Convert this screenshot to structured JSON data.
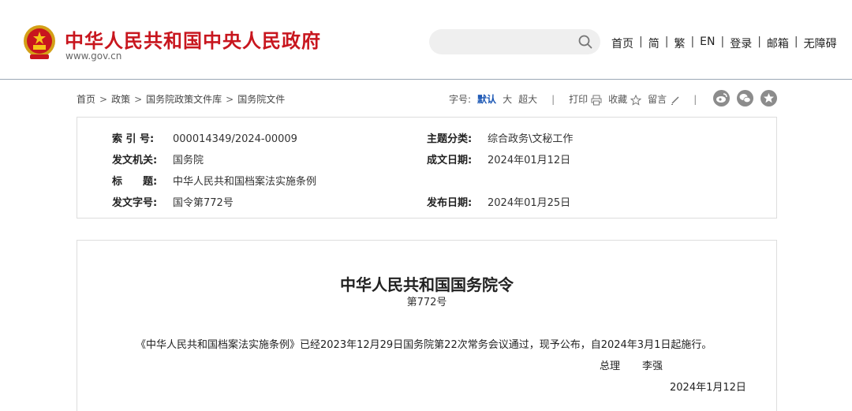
{
  "header": {
    "site_title": "中华人民共和国中央人民政府",
    "site_url": "www.gov.cn",
    "search": {
      "value": "",
      "placeholder": ""
    },
    "nav": [
      "首页",
      "简",
      "繁",
      "EN",
      "登录",
      "邮箱",
      "无障碍"
    ],
    "nav_separator": "|"
  },
  "breadcrumb": {
    "items": [
      "首页",
      "政策",
      "国务院政策文件库",
      "国务院文件"
    ],
    "separator": ">"
  },
  "toolbar": {
    "font_size_label": "字号:",
    "font_default": "默认",
    "font_large": "大",
    "font_xlarge": "超大",
    "divider": "|",
    "print_label": "打印",
    "favorite_label": "收藏",
    "comment_label": "留言"
  },
  "share_icons": [
    "weibo-icon",
    "wechat-icon",
    "qzone-star-icon"
  ],
  "info": {
    "index_label": "索 引 号:",
    "index_value": "000014349/2024-00009",
    "category_label": "主题分类:",
    "category_value": "综合政务\\文秘工作",
    "issuer_label": "发文机关:",
    "issuer_value": "国务院",
    "written_date_label": "成文日期:",
    "written_date_value": "2024年01月12日",
    "title_label": "标　　题:",
    "title_value": "中华人民共和国档案法实施条例",
    "doc_number_label": "发文字号:",
    "doc_number_value": "国令第772号",
    "publish_date_label": "发布日期:",
    "publish_date_value": "2024年01月25日"
  },
  "document": {
    "title": "中华人民共和国国务院令",
    "number": "第772号",
    "body": "《中华人民共和国档案法实施条例》已经2023年12月29日国务院第22次常务会议通过，现予公布，自2024年3月1日起施行。",
    "signatory_title": "总理",
    "signatory_name": "李强",
    "date": "2024年1月12日"
  },
  "colors": {
    "brand_red": "#c8161e",
    "link_blue": "#1a56b4",
    "share_gray": "#8c8c8c"
  }
}
